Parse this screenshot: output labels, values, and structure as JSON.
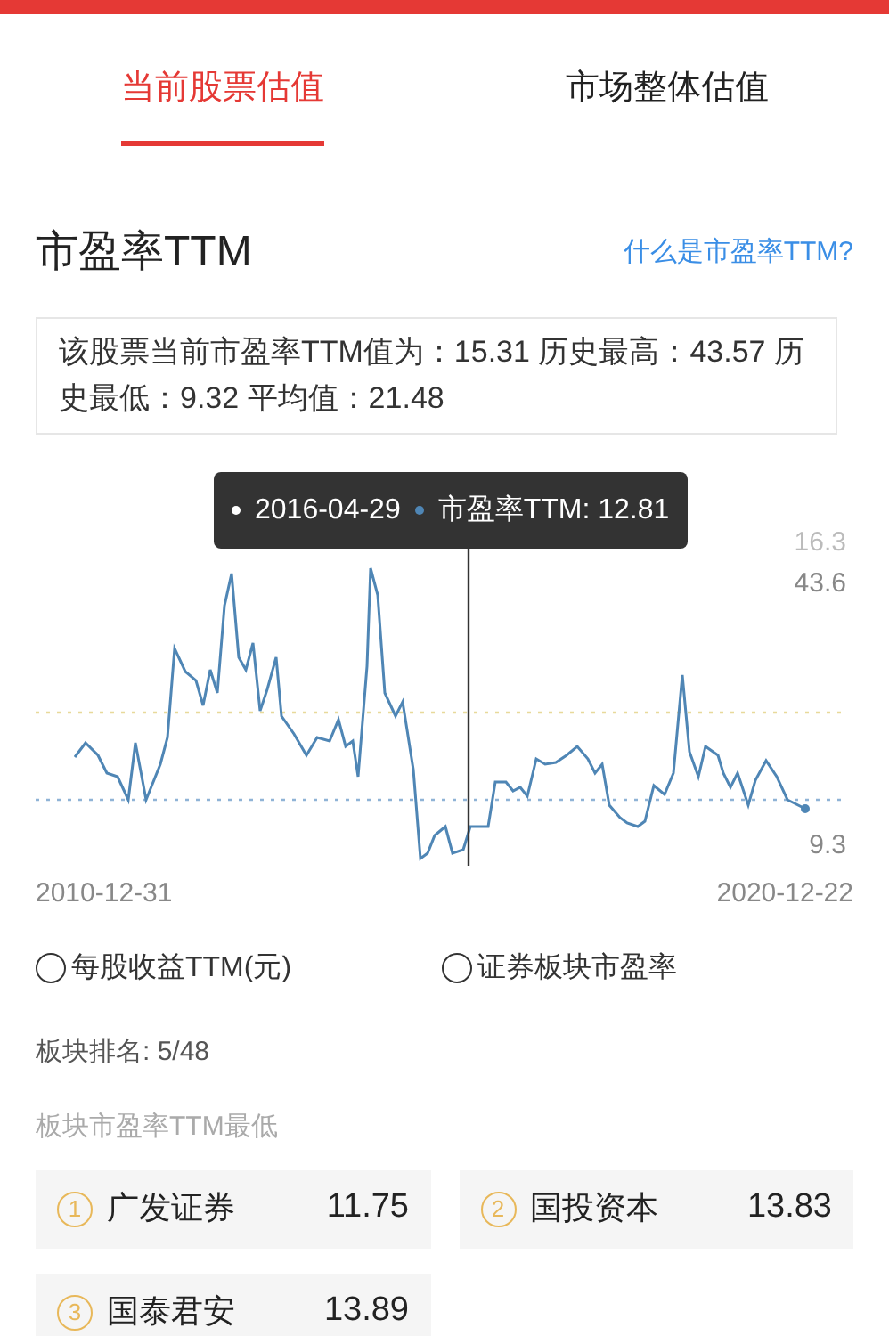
{
  "tabs": [
    {
      "label": "当前股票估值",
      "selected": true
    },
    {
      "label": "市场整体估值",
      "selected": false
    }
  ],
  "section": {
    "title": "市盈率TTM",
    "help_link": "什么是市盈率TTM?"
  },
  "summary": "该股票当前市盈率TTM值为：15.31 历史最高：43.57 历史最低：9.32 平均值：21.48",
  "chart": {
    "tooltip": {
      "date": "2016-04-29",
      "series": "市盈率TTM: 12.81"
    },
    "legend_value": "16.3",
    "max_label": "43.6",
    "min_label": "9.3",
    "start_date": "2010-12-31",
    "end_date": "2020-12-22"
  },
  "options": [
    {
      "label": "每股收益TTM(元)",
      "selected": false
    },
    {
      "label": "证券板块市盈率",
      "selected": false
    }
  ],
  "rank": "板块排名: 5/48",
  "lowest_title": "板块市盈率TTM最低",
  "lowest": [
    {
      "rank": "1",
      "name": "广发证券",
      "value": "11.75"
    },
    {
      "rank": "2",
      "name": "国投资本",
      "value": "13.83"
    },
    {
      "rank": "3",
      "name": "国泰君安",
      "value": "13.89"
    }
  ]
}
